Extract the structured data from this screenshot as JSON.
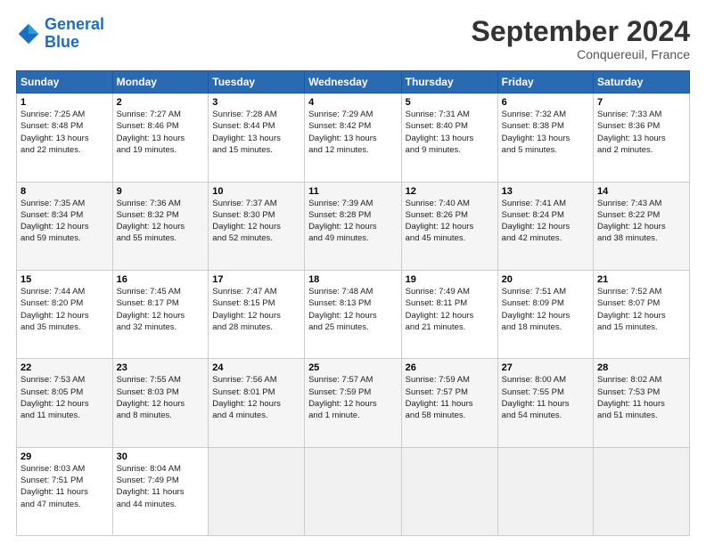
{
  "header": {
    "logo_line1": "General",
    "logo_line2": "Blue",
    "month": "September 2024",
    "location": "Conquereuil, France"
  },
  "days_of_week": [
    "Sunday",
    "Monday",
    "Tuesday",
    "Wednesday",
    "Thursday",
    "Friday",
    "Saturday"
  ],
  "weeks": [
    [
      {
        "day": "1",
        "info": "Sunrise: 7:25 AM\nSunset: 8:48 PM\nDaylight: 13 hours\nand 22 minutes."
      },
      {
        "day": "2",
        "info": "Sunrise: 7:27 AM\nSunset: 8:46 PM\nDaylight: 13 hours\nand 19 minutes."
      },
      {
        "day": "3",
        "info": "Sunrise: 7:28 AM\nSunset: 8:44 PM\nDaylight: 13 hours\nand 15 minutes."
      },
      {
        "day": "4",
        "info": "Sunrise: 7:29 AM\nSunset: 8:42 PM\nDaylight: 13 hours\nand 12 minutes."
      },
      {
        "day": "5",
        "info": "Sunrise: 7:31 AM\nSunset: 8:40 PM\nDaylight: 13 hours\nand 9 minutes."
      },
      {
        "day": "6",
        "info": "Sunrise: 7:32 AM\nSunset: 8:38 PM\nDaylight: 13 hours\nand 5 minutes."
      },
      {
        "day": "7",
        "info": "Sunrise: 7:33 AM\nSunset: 8:36 PM\nDaylight: 13 hours\nand 2 minutes."
      }
    ],
    [
      {
        "day": "8",
        "info": "Sunrise: 7:35 AM\nSunset: 8:34 PM\nDaylight: 12 hours\nand 59 minutes."
      },
      {
        "day": "9",
        "info": "Sunrise: 7:36 AM\nSunset: 8:32 PM\nDaylight: 12 hours\nand 55 minutes."
      },
      {
        "day": "10",
        "info": "Sunrise: 7:37 AM\nSunset: 8:30 PM\nDaylight: 12 hours\nand 52 minutes."
      },
      {
        "day": "11",
        "info": "Sunrise: 7:39 AM\nSunset: 8:28 PM\nDaylight: 12 hours\nand 49 minutes."
      },
      {
        "day": "12",
        "info": "Sunrise: 7:40 AM\nSunset: 8:26 PM\nDaylight: 12 hours\nand 45 minutes."
      },
      {
        "day": "13",
        "info": "Sunrise: 7:41 AM\nSunset: 8:24 PM\nDaylight: 12 hours\nand 42 minutes."
      },
      {
        "day": "14",
        "info": "Sunrise: 7:43 AM\nSunset: 8:22 PM\nDaylight: 12 hours\nand 38 minutes."
      }
    ],
    [
      {
        "day": "15",
        "info": "Sunrise: 7:44 AM\nSunset: 8:20 PM\nDaylight: 12 hours\nand 35 minutes."
      },
      {
        "day": "16",
        "info": "Sunrise: 7:45 AM\nSunset: 8:17 PM\nDaylight: 12 hours\nand 32 minutes."
      },
      {
        "day": "17",
        "info": "Sunrise: 7:47 AM\nSunset: 8:15 PM\nDaylight: 12 hours\nand 28 minutes."
      },
      {
        "day": "18",
        "info": "Sunrise: 7:48 AM\nSunset: 8:13 PM\nDaylight: 12 hours\nand 25 minutes."
      },
      {
        "day": "19",
        "info": "Sunrise: 7:49 AM\nSunset: 8:11 PM\nDaylight: 12 hours\nand 21 minutes."
      },
      {
        "day": "20",
        "info": "Sunrise: 7:51 AM\nSunset: 8:09 PM\nDaylight: 12 hours\nand 18 minutes."
      },
      {
        "day": "21",
        "info": "Sunrise: 7:52 AM\nSunset: 8:07 PM\nDaylight: 12 hours\nand 15 minutes."
      }
    ],
    [
      {
        "day": "22",
        "info": "Sunrise: 7:53 AM\nSunset: 8:05 PM\nDaylight: 12 hours\nand 11 minutes."
      },
      {
        "day": "23",
        "info": "Sunrise: 7:55 AM\nSunset: 8:03 PM\nDaylight: 12 hours\nand 8 minutes."
      },
      {
        "day": "24",
        "info": "Sunrise: 7:56 AM\nSunset: 8:01 PM\nDaylight: 12 hours\nand 4 minutes."
      },
      {
        "day": "25",
        "info": "Sunrise: 7:57 AM\nSunset: 7:59 PM\nDaylight: 12 hours\nand 1 minute."
      },
      {
        "day": "26",
        "info": "Sunrise: 7:59 AM\nSunset: 7:57 PM\nDaylight: 11 hours\nand 58 minutes."
      },
      {
        "day": "27",
        "info": "Sunrise: 8:00 AM\nSunset: 7:55 PM\nDaylight: 11 hours\nand 54 minutes."
      },
      {
        "day": "28",
        "info": "Sunrise: 8:02 AM\nSunset: 7:53 PM\nDaylight: 11 hours\nand 51 minutes."
      }
    ],
    [
      {
        "day": "29",
        "info": "Sunrise: 8:03 AM\nSunset: 7:51 PM\nDaylight: 11 hours\nand 47 minutes."
      },
      {
        "day": "30",
        "info": "Sunrise: 8:04 AM\nSunset: 7:49 PM\nDaylight: 11 hours\nand 44 minutes."
      },
      {
        "day": "",
        "info": ""
      },
      {
        "day": "",
        "info": ""
      },
      {
        "day": "",
        "info": ""
      },
      {
        "day": "",
        "info": ""
      },
      {
        "day": "",
        "info": ""
      }
    ]
  ]
}
